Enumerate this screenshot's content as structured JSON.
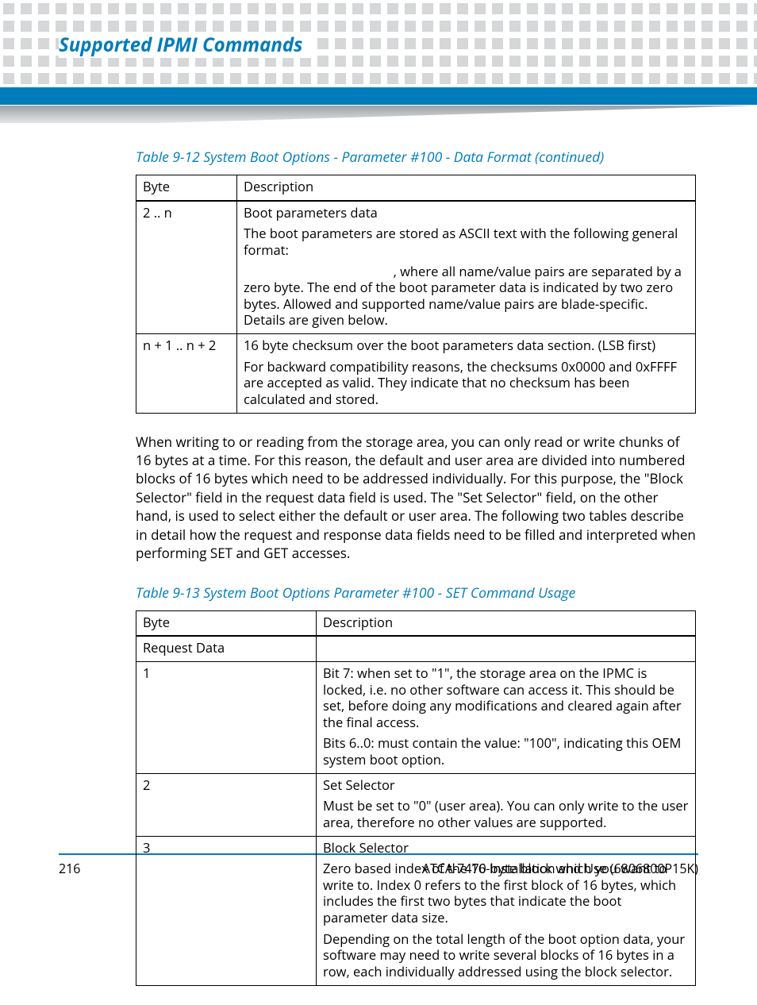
{
  "header": {
    "title": "Supported IPMI Commands"
  },
  "table1": {
    "caption": "Table 9-12 System Boot Options - Parameter #100 - Data Format  (continued)",
    "col1_header": "Byte",
    "col2_header": "Description",
    "rows": [
      {
        "c1": "2 .. n",
        "c2_p1": "Boot parameters data",
        "c2_p2": "The boot parameters are stored as ASCII text with the following general format:",
        "c2_p3": ", where all name/value pairs are separated by a zero byte. The end of the boot parameter data is indicated by two zero bytes. Allowed and supported name/value pairs are blade-specific. Details are given below.",
        "c2_p3_pad": "                                            "
      },
      {
        "c1": "n + 1 .. n + 2",
        "c2_p1": "16 byte checksum over the boot parameters data section. (LSB first)",
        "c2_p2": "For backward compatibility reasons, the checksums 0x0000 and 0xFFFF are accepted as valid. They indicate that no checksum has been calculated and stored."
      }
    ]
  },
  "paragraph": "When writing to or reading from the storage area, you can only read or write chunks of 16 bytes at a time. For this reason, the default and user area are divided into numbered blocks of 16 bytes which need to be addressed individually. For this purpose, the \"Block Selector\" field in the request data field is used. The \"Set Selector\" field, on the other hand, is used to select either the default or user area. The following two tables describe in detail how the request and response data fields need to be filled and interpreted when performing SET and GET accesses.",
  "table2": {
    "caption": "Table 9-13 System Boot Options Parameter #100 - SET Command Usage",
    "col1_header": "Byte",
    "col2_header": "Description",
    "rows": [
      {
        "c1": "Request Data",
        "c2": ""
      },
      {
        "c1": "1",
        "c2_p1": "Bit 7: when set to \"1\", the storage area on the IPMC is locked, i.e. no other software can access it. This should be set, before doing any modifications and cleared again after the final access.",
        "c2_p2": "Bits 6..0: must contain the value: \"100\", indicating this OEM system boot option."
      },
      {
        "c1": "2",
        "c2_p1": "Set Selector",
        "c2_p2": "Must be set to \"0\" (user area). You can only write to the user area, therefore no other values are supported."
      },
      {
        "c1": "3",
        "c2_p1": "Block Selector",
        "c2_p2": "Zero based index of the 16-byte block which you want to write to. Index 0 refers to the first block of 16 bytes, which includes the first two bytes that indicate the boot parameter data size.",
        "c2_p3": "Depending on the total length of the boot option data, your software may need to write several blocks of 16 bytes in a row, each individually addressed using the block selector."
      }
    ]
  },
  "footer": {
    "page": "216",
    "doc": "ATCA-7470 Installation and Use (6806800P15K)"
  }
}
